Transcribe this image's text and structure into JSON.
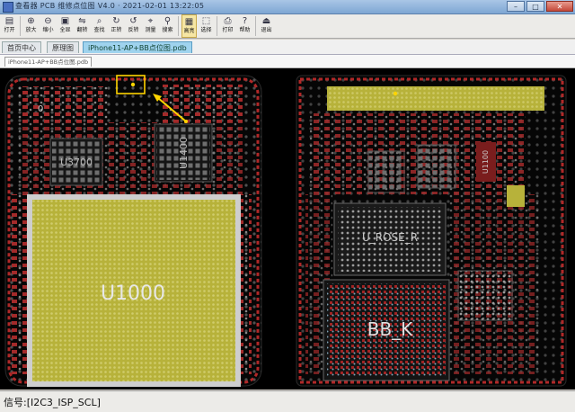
{
  "window": {
    "title": "查看器 PCB 维修点位图 V4.0 · 2021-02-01 13:22:05",
    "buttons": {
      "minimize": "–",
      "maximize": "□",
      "close": "✕"
    }
  },
  "toolbar": {
    "items": [
      {
        "label": "打开",
        "icon": "folder-open-icon"
      },
      {
        "label": "放大",
        "icon": "zoom-in-icon"
      },
      {
        "label": "缩小",
        "icon": "zoom-out-icon"
      },
      {
        "label": "全显",
        "icon": "fit-icon"
      },
      {
        "label": "翻转",
        "icon": "mirror-icon"
      },
      {
        "label": "查找",
        "icon": "search-icon"
      },
      {
        "label": "正转",
        "icon": "rotate-cw-icon"
      },
      {
        "label": "反转",
        "icon": "rotate-ccw-icon"
      },
      {
        "label": "测量",
        "icon": "measure-icon"
      },
      {
        "label": "搜索",
        "icon": "locate-icon"
      },
      {
        "label": "高亮",
        "icon": "highlight-icon"
      },
      {
        "label": "选择",
        "icon": "select-icon"
      },
      {
        "label": "打印",
        "icon": "print-icon"
      },
      {
        "label": "帮助",
        "icon": "help-icon"
      },
      {
        "label": "退出",
        "icon": "exit-icon"
      }
    ]
  },
  "tabs": [
    {
      "label": "首页中心"
    },
    {
      "label": "原理图"
    },
    {
      "label": "iPhone11-AP+BB点位图.pdb"
    }
  ],
  "doc_tab": "iPhone11-AP+BB点位图.pdb",
  "board": {
    "labels": {
      "u3700": "U3700",
      "u1400": "U1400",
      "u1000": "U1000",
      "u_rose": "U_ROSE_R",
      "bb_k": "BB_K",
      "u1100": "U1100",
      "small_o": "0"
    },
    "colors": {
      "background": "#000000",
      "pad_red": "#b02828",
      "pad_grey": "#8a8a8a",
      "highlight": "#b7b23a",
      "selection": "#ffd400"
    }
  },
  "status": {
    "signal_label": "信号:",
    "signal_value": "[I2C3_ISP_SCL]"
  }
}
